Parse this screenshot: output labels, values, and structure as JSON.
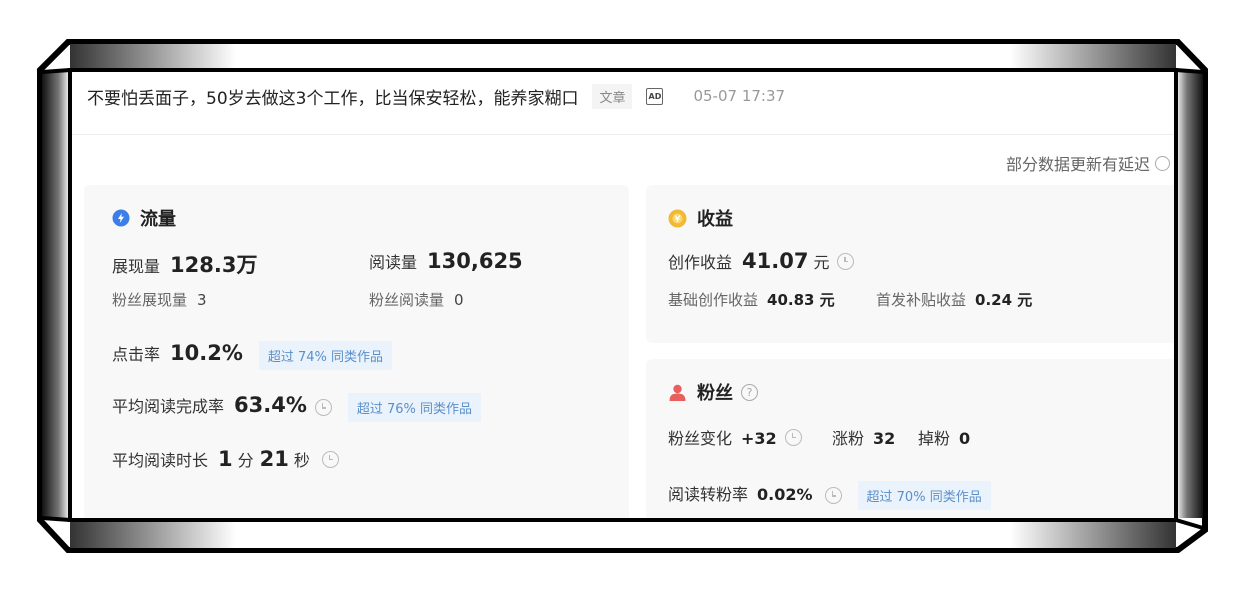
{
  "article": {
    "title": "不要怕丢面子，50岁去做这3个工作，比当保安轻松，能养家糊口",
    "tag": "文章",
    "ad_badge": "AD",
    "time": "05-07 17:37"
  },
  "note": "部分数据更新有延迟",
  "traffic": {
    "title": "流量",
    "icon": "flame-drop-icon",
    "icon_color": "#3d7fe8",
    "impressions_label": "展现量",
    "impressions_value": "128.3万",
    "reads_label": "阅读量",
    "reads_value": "130,625",
    "fan_impressions_label": "粉丝展现量",
    "fan_impressions_value": "3",
    "fan_reads_label": "粉丝阅读量",
    "fan_reads_value": "0",
    "ctr_label": "点击率",
    "ctr_value": "10.2%",
    "ctr_badge": "超过 74% 同类作品",
    "completion_label": "平均阅读完成率",
    "completion_value": "63.4%",
    "completion_badge": "超过 76% 同类作品",
    "duration_label": "平均阅读时长",
    "duration_min": "1",
    "duration_min_unit": "分",
    "duration_sec": "21",
    "duration_sec_unit": "秒"
  },
  "income": {
    "title": "收益",
    "icon": "coin-icon",
    "icon_color": "#f2b935",
    "creation_label": "创作收益",
    "creation_value": "41.07",
    "creation_unit": "元",
    "basic_label": "基础创作收益",
    "basic_value": "40.83 元",
    "subsidy_label": "首发补贴收益",
    "subsidy_value": "0.24 元"
  },
  "fans": {
    "title": "粉丝",
    "icon": "user-icon",
    "icon_color": "#e8605d",
    "help_icon": "?",
    "change_label": "粉丝变化",
    "change_value": "+32",
    "gain_label": "涨粉",
    "gain_value": "32",
    "loss_label": "掉粉",
    "loss_value": "0",
    "conversion_label": "阅读转粉率",
    "conversion_value": "0.02%",
    "conversion_badge": "超过 70% 同类作品"
  }
}
